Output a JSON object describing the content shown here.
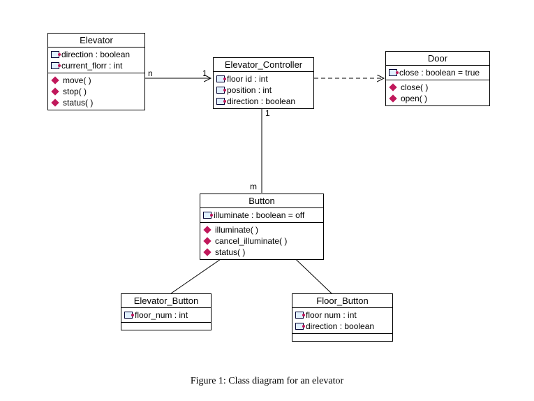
{
  "caption": "Figure 1: Class diagram for an elevator",
  "classes": {
    "elevator": {
      "name": "Elevator",
      "attrs": [
        "direction : boolean",
        "current_florr : int"
      ],
      "ops": [
        "move( )",
        "stop( )",
        "status( )"
      ]
    },
    "controller": {
      "name": "Elevator_Controller",
      "attrs": [
        "floor id : int",
        "position : int",
        "direction : boolean"
      ],
      "ops": []
    },
    "door": {
      "name": "Door",
      "attrs": [
        "close : boolean = true"
      ],
      "ops": [
        "close( )",
        "open( )"
      ]
    },
    "button": {
      "name": "Button",
      "attrs": [
        "illuminate : boolean = off"
      ],
      "ops": [
        "illuminate( )",
        "cancel_illuminate( )",
        "status( )"
      ]
    },
    "elevatorButton": {
      "name": "Elevator_Button",
      "attrs": [
        "floor_num : int"
      ],
      "ops": []
    },
    "floorButton": {
      "name": "Floor_Button",
      "attrs": [
        "floor num : int",
        "direction : boolean"
      ],
      "ops": []
    }
  },
  "multiplicities": {
    "n": "n",
    "one_a": "1",
    "one_b": "1",
    "m": "m"
  }
}
